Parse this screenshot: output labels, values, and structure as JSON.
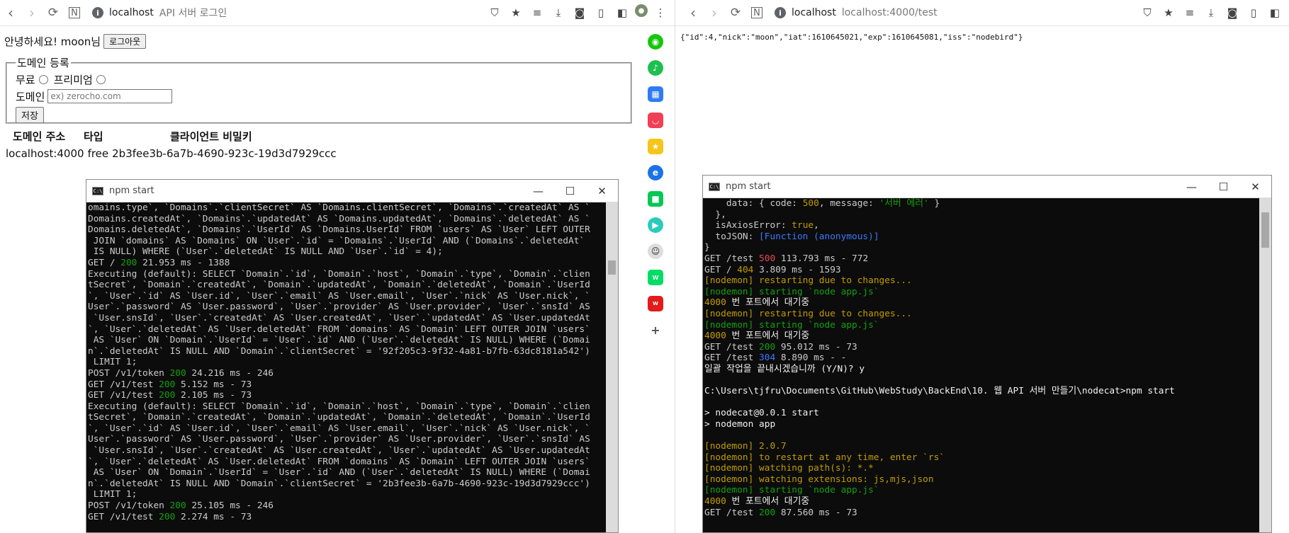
{
  "left_browser": {
    "host": "localhost",
    "title": "API 서버 로그인",
    "greeting": "안녕하세요! moon님",
    "logout_label": "로그아웃",
    "form": {
      "legend": "도메인 등록",
      "free_label": "무료",
      "premium_label": "프리미엄",
      "domain_label": "도메인",
      "domain_placeholder": "ex) zerocho.com",
      "save_label": "저장"
    },
    "table": {
      "headers": [
        "도메인 주소",
        "타입",
        "클라이언트 비밀키"
      ],
      "rows": [
        [
          "localhost:4000",
          "free",
          "2b3fee3b-6a7b-4690-923c-19d3d7929ccc"
        ]
      ]
    }
  },
  "right_browser": {
    "host": "localhost",
    "url": "localhost:4000/test",
    "json_text": "{\"id\":4,\"nick\":\"moon\",\"iat\":1610645021,\"exp\":1610645081,\"iss\":\"nodebird\"}"
  },
  "terminal_left": {
    "title": "npm start",
    "lines": [
      "omains.type`, `Domains`.`clientSecret` AS `Domains.clientSecret`, `Domains`.`createdAt` AS `",
      "Domains.createdAt`, `Domains`.`updatedAt` AS `Domains.updatedAt`, `Domains`.`deletedAt` AS `",
      "Domains.deletedAt`, `Domains`.`UserId` AS `Domains.UserId` FROM `users` AS `User` LEFT OUTER",
      " JOIN `domains` AS `Domains` ON `User`.`id` = `Domains`.`UserId` AND (`Domains`.`deletedAt`",
      " IS NULL) WHERE (`User`.`deletedAt` IS NULL AND `User`.`id` = 4);",
      "GET / |200| 21.953 ms - 1388",
      "Executing (default): SELECT `Domain`.`id`, `Domain`.`host`, `Domain`.`type`, `Domain`.`clien",
      "tSecret`, `Domain`.`createdAt`, `Domain`.`updatedAt`, `Domain`.`deletedAt`, `Domain`.`UserId",
      "`, `User`.`id` AS `User.id`, `User`.`email` AS `User.email`, `User`.`nick` AS `User.nick`, `",
      "User`.`password` AS `User.password`, `User`.`provider` AS `User.provider`, `User`.`snsId` AS",
      " `User.snsId`, `User`.`createdAt` AS `User.createdAt`, `User`.`updatedAt` AS `User.updatedAt",
      "`, `User`.`deletedAt` AS `User.deletedAt` FROM `domains` AS `Domain` LEFT OUTER JOIN `users`",
      " AS `User` ON `Domain`.`UserId` = `User`.`id` AND (`User`.`deletedAt` IS NULL) WHERE (`Domai",
      "n`.`deletedAt` IS NULL AND `Domain`.`clientSecret` = '92f205c3-9f32-4a81-b7fb-63dc8181a542')",
      " LIMIT 1;",
      "POST /v1/token |200| 24.216 ms - 246",
      "GET /v1/test |200| 5.152 ms - 73",
      "GET /v1/test |200| 2.105 ms - 73",
      "Executing (default): SELECT `Domain`.`id`, `Domain`.`host`, `Domain`.`type`, `Domain`.`clien",
      "tSecret`, `Domain`.`createdAt`, `Domain`.`updatedAt`, `Domain`.`deletedAt`, `Domain`.`UserId",
      "`, `User`.`id` AS `User.id`, `User`.`email` AS `User.email`, `User`.`nick` AS `User.nick`, `",
      "User`.`password` AS `User.password`, `User`.`provider` AS `User.provider`, `User`.`snsId` AS",
      " `User.snsId`, `User`.`createdAt` AS `User.createdAt`, `User`.`updatedAt` AS `User.updatedAt",
      "`, `User`.`deletedAt` AS `User.deletedAt` FROM `domains` AS `Domain` LEFT OUTER JOIN `users`",
      " AS `User` ON `Domain`.`UserId` = `User`.`id` AND (`User`.`deletedAt` IS NULL) WHERE (`Domai",
      "n`.`deletedAt` IS NULL AND `Domain`.`clientSecret` = '2b3fee3b-6a7b-4690-923c-19d3d7929ccc')",
      " LIMIT 1;",
      "POST /v1/token |200| 25.105 ms - 246",
      "GET /v1/test |200| 2.274 ms - 73"
    ]
  },
  "terminal_right": {
    "title": "npm start",
    "lines": [
      "    data: { code: 500, message: '서버 에러' }",
      "  },",
      "  isAxiosError: true,",
      "  toJSON: [Function (anonymous)]",
      "}",
      "GET /test 500 113.793 ms - 772",
      "GET / 404 3.809 ms - 1593",
      "[nodemon] restarting due to changes...",
      "[nodemon] starting `node app.js`",
      "4000 번 포트에서 대기중",
      "[nodemon] restarting due to changes...",
      "[nodemon] starting `node app.js`",
      "4000 번 포트에서 대기중",
      "GET /test 200 95.012 ms - 73",
      "GET /test 304 8.890 ms - -",
      "일괄 작업을 끝내시겠습니까 (Y/N)? y",
      "",
      "C:\\Users\\tjfru\\Documents\\GitHub\\WebStudy\\BackEnd\\10. 웹 API 서버 만들기\\nodecat>npm start",
      "",
      "> nodecat@0.0.1 start",
      "> nodemon app",
      "",
      "[nodemon] 2.0.7",
      "[nodemon] to restart at any time, enter `rs`",
      "[nodemon] watching path(s): *.*",
      "[nodemon] watching extensions: js,mjs,json",
      "[nodemon] starting `node app.js`",
      "4000 번 포트에서 대기중",
      "GET /test 200 87.560 ms - 73"
    ]
  },
  "colors": {
    "terminal_bg": "#0c0c0c",
    "terminal_text": "#cccccc",
    "green": "#13a10e",
    "red": "#e74856",
    "yellow": "#c19c00",
    "blue": "#3b78ff"
  }
}
